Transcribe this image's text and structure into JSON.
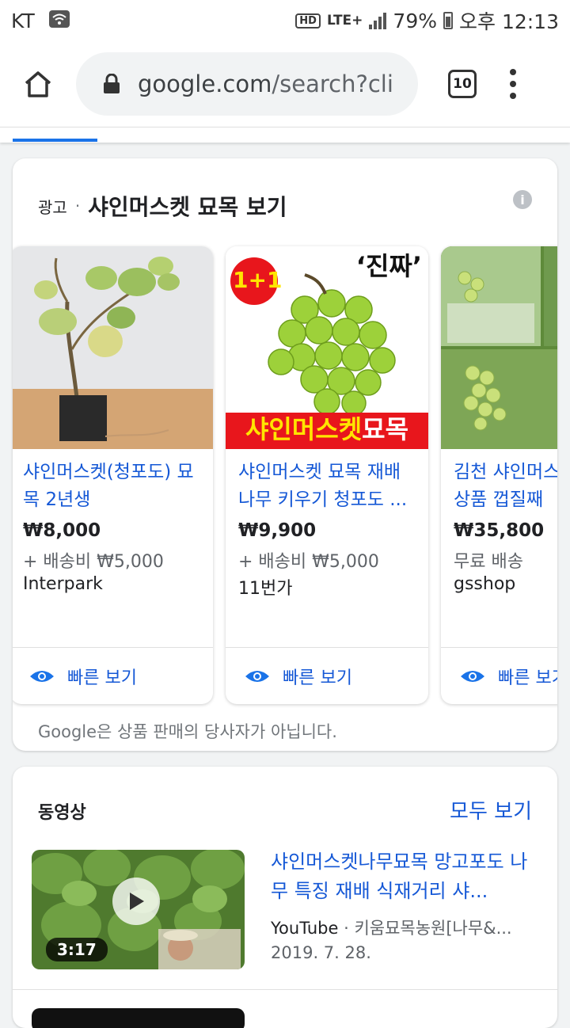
{
  "status_bar": {
    "carrier": "KT",
    "hd": "HD",
    "network": "LTE+",
    "battery": "79%",
    "time": "오후 12:13"
  },
  "browser": {
    "url": "google.com/search?cli",
    "url_host": "google.com",
    "url_path": "/search?cli",
    "tab_count": "10",
    "icons": [
      "home-icon",
      "lock-icon",
      "tab-switcher-icon",
      "more-vert-icon"
    ]
  },
  "ads": {
    "label": "광고",
    "separator": "·",
    "title": "샤인머스켓 묘목 보기",
    "info_icon": "i",
    "products": [
      {
        "name": "샤인머스켓(청포도) 묘목 2년생",
        "price": "₩8,000",
        "shipping": "+ 배송비 ₩5,000",
        "seller": "Interpark",
        "quick_view": "빠른 보기"
      },
      {
        "name": "샤인머스켓 묘목 재배 나무 키우기 청포도 ...",
        "price": "₩9,900",
        "shipping": "+ 배송비 ₩5,000",
        "seller": "11번가",
        "quick_view": "빠른 보기",
        "image_texts": {
          "badge": "1+1",
          "corner": "‘진짜’",
          "banner_left": "샤인머스켓",
          "banner_right": "묘목"
        }
      },
      {
        "name": "김천 샤인머스켓 용 최상품 껍질째",
        "price": "₩35,800",
        "shipping": "무료 배송",
        "seller": "gsshop",
        "quick_view": "빠른 보기"
      }
    ],
    "disclaimer": "Google은 상품 판매의 당사자가 아닙니다."
  },
  "videos": {
    "section_title": "동영상",
    "see_all": "모두 보기",
    "items": [
      {
        "title": "샤인머스켓나무묘목 망고포도 나무 특징 재배 식재거리 샤...",
        "source": "YouTube",
        "channel": "키움묘목농원[나무&...",
        "date": "2019. 7. 28.",
        "duration": "3:17"
      }
    ]
  },
  "colors": {
    "link": "#1558d6",
    "accent": "#1a73e8",
    "background": "#f1f3f4"
  }
}
